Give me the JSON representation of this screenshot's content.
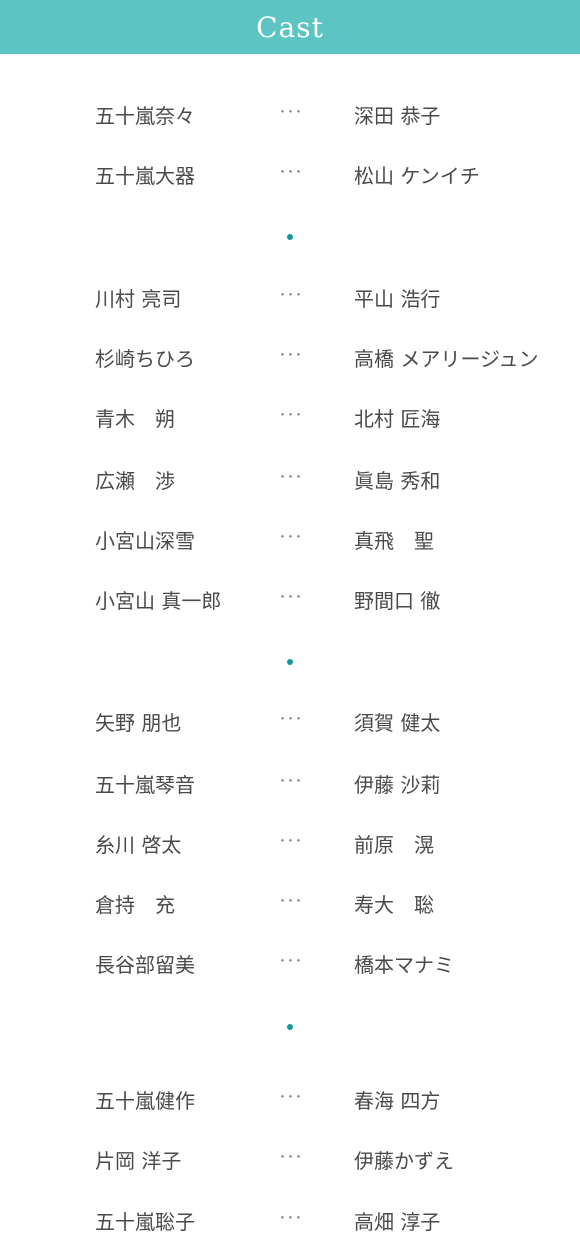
{
  "header": {
    "title": "Cast",
    "background": "#5cc5c4"
  },
  "separator": "･･･",
  "divider_color": "#12999b",
  "groups": [
    {
      "rows": [
        {
          "role": "五十嵐奈々",
          "actor": "深田 恭子"
        },
        {
          "role": "五十嵐大器",
          "actor": "松山 ケンイチ"
        }
      ]
    },
    {
      "rows": [
        {
          "role": "川村 亮司",
          "actor": "平山 浩行"
        },
        {
          "role": "杉崎ちひろ",
          "actor": "高橋 メアリージュン"
        },
        {
          "role": "青木　朔",
          "actor": "北村 匠海"
        },
        {
          "role": "広瀬　渉",
          "actor": "眞島 秀和"
        },
        {
          "role": "小宮山深雪",
          "actor": "真飛　聖"
        },
        {
          "role": "小宮山 真一郎",
          "actor": "野間口 徹"
        }
      ]
    },
    {
      "rows": [
        {
          "role": "矢野 朋也",
          "actor": "須賀 健太"
        },
        {
          "role": "五十嵐琴音",
          "actor": "伊藤 沙莉"
        },
        {
          "role": "糸川 啓太",
          "actor": "前原　滉"
        },
        {
          "role": "倉持　充",
          "actor": "寿大　聡"
        },
        {
          "role": "長谷部留美",
          "actor": "橋本マナミ"
        }
      ]
    },
    {
      "rows": [
        {
          "role": "五十嵐健作",
          "actor": "春海 四方"
        },
        {
          "role": "片岡 洋子",
          "actor": "伊藤かずえ"
        },
        {
          "role": "五十嵐聡子",
          "actor": "高畑 淳子"
        }
      ]
    }
  ]
}
